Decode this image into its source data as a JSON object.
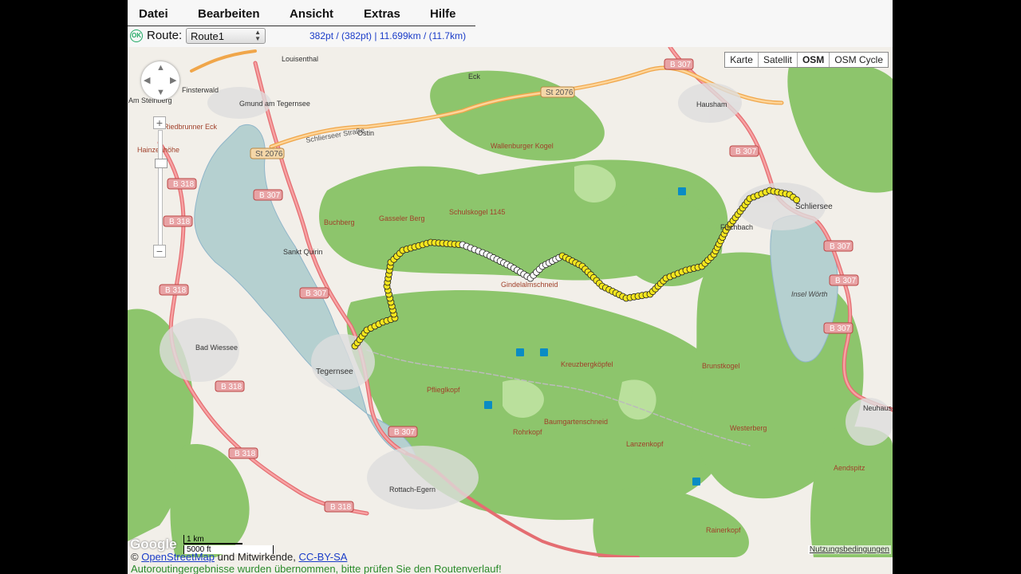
{
  "menu": {
    "items": [
      "Datei",
      "Bearbeiten",
      "Ansicht",
      "Extras",
      "Hilfe"
    ]
  },
  "routebar": {
    "ok_icon": "OK",
    "route_label": "Route:",
    "route_value": "Route1",
    "stats": "382pt / (382pt) | 11.699km / (11.7km)"
  },
  "map": {
    "type_buttons": [
      "Karte",
      "Satellit",
      "OSM",
      "OSM Cycle"
    ],
    "active_type": "OSM",
    "labels": {
      "louisenthal": "Louisenthal",
      "finsterwald": "Finsterwald",
      "amsteinberg": "Am Steinberg",
      "gmund": "Gmund am Tegernsee",
      "eck": "Eck",
      "hausham": "Hausham",
      "schlierseerstrasse": "Schlierseer Straße",
      "ostin": "Ostin",
      "waldberg": "Wallenburger Kogel",
      "kogel": "Schulskogel 1145",
      "gasse": "Gasseler Berg",
      "buchberg": "Buchberg",
      "sanktquirin": "Sankt Quirin",
      "gindelalm": "Gindelalmschneid",
      "badwiessee": "Bad Wiessee",
      "tegernsee": "Tegernsee",
      "pflieglkopf": "Pflieglkopf",
      "kreuzberg": "Kreuzbergköpfel",
      "brunstkogel": "Brunstkogel",
      "baumgarten": "Baumgartenschneid",
      "rohrkopf": "Rohrkopf",
      "westerberg": "Westerberg",
      "rottach": "Rottach-Egern",
      "inselworth": "Insel Wörth",
      "schliersee": "Schliersee",
      "neuhaus": "Neuhaus",
      "aendspitz": "Aendspitz",
      "rainerkopf": "Rainerkopf",
      "fischbach": "Fischbach",
      "hainzenhohe": "Hainzenhöhe",
      "riedbergereck": "Riedbrunner Eck",
      "lanzenkopf": "Lanzenkopf"
    },
    "road_labels": {
      "b307a": "B 307",
      "b307b": "B 307",
      "b307c": "B 307",
      "b307d": "B 307",
      "b307e": "B 307",
      "b307f": "B 307",
      "b307g": "B 307",
      "b307h": "B 307",
      "b318a": "B 318",
      "b318b": "B 318",
      "b318c": "B 318",
      "b318d": "B 318",
      "b318e": "B 318",
      "b318f": "B 318",
      "st2076a": "St 2076",
      "st2076b": "St 2076"
    },
    "scale": {
      "km": "1 km",
      "ft": "5000 ft"
    },
    "google": "Google",
    "terms": "Nutzungsbedingungen"
  },
  "footer": {
    "attribution_prefix": "© ",
    "osm_link": "OpenStreetMap",
    "attribution_mid": " und Mitwirkende, ",
    "license_link": "CC-BY-SA",
    "status": "Autoroutingergebnisse wurden übernommen, bitte prüfen Sie den Routenverlauf!"
  },
  "colors": {
    "forest": "#8dc56c",
    "water": "#b5d0d0",
    "land": "#f2efe9",
    "road_primary": "#e46d71",
    "road_secondary": "#fdbf6f",
    "route_point": "#f5e61e",
    "link": "#1a3cc8",
    "status": "#2a8a2a"
  }
}
